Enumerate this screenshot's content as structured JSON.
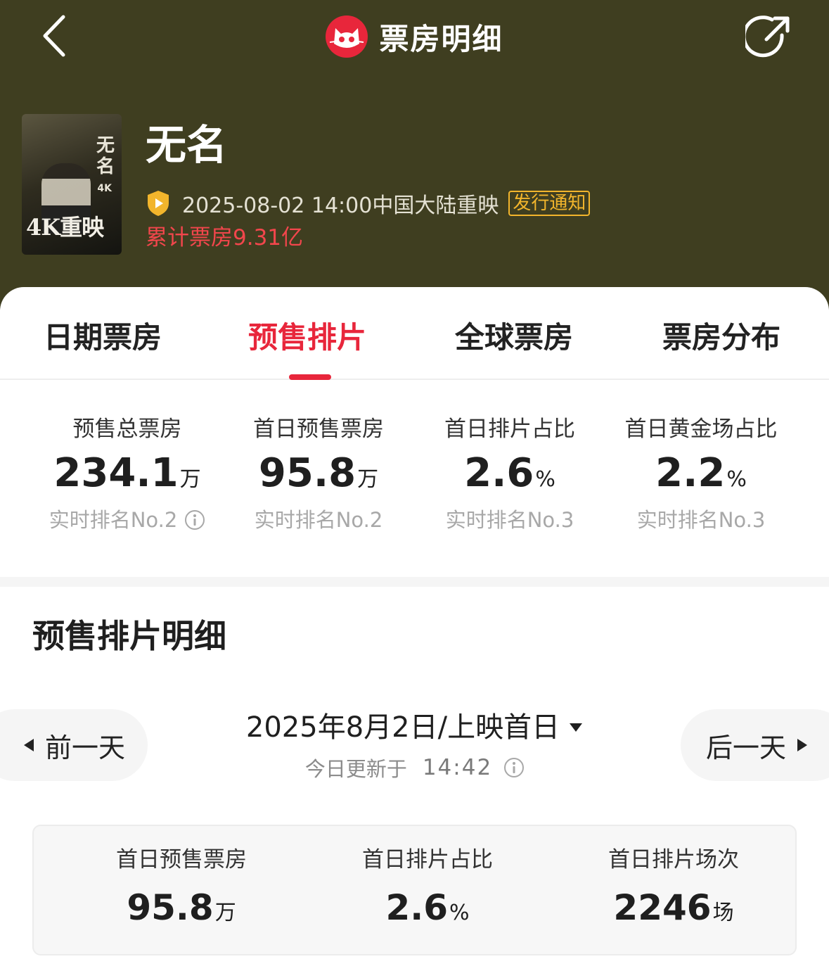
{
  "app": {
    "title": "票房明细"
  },
  "movie": {
    "name": "无名",
    "poster": {
      "title_vertical": "无名",
      "badge_small": "4K",
      "tag": "4K重映"
    },
    "release_info": "2025-08-02 14:00中国大陆重映",
    "notice_badge": "发行通知",
    "total_box_office": "累计票房9.31亿"
  },
  "tabs": [
    {
      "label": "日期票房",
      "active": false
    },
    {
      "label": "预售排片",
      "active": true
    },
    {
      "label": "全球票房",
      "active": false
    },
    {
      "label": "票房分布",
      "active": false
    }
  ],
  "stats": [
    {
      "label": "预售总票房",
      "value": "234.1",
      "unit": "万",
      "rank": "实时排名No.2",
      "has_info": true
    },
    {
      "label": "首日预售票房",
      "value": "95.8",
      "unit": "万",
      "rank": "实时排名No.2",
      "has_info": false
    },
    {
      "label": "首日排片占比",
      "value": "2.6",
      "unit": "%",
      "rank": "实时排名No.3",
      "has_info": false
    },
    {
      "label": "首日黄金场占比",
      "value": "2.2",
      "unit": "%",
      "rank": "实时排名No.3",
      "has_info": false
    }
  ],
  "detail": {
    "section_title": "预售排片明细",
    "prev_day": "前一天",
    "next_day": "后一天",
    "date_label": "2025年8月2日/上映首日",
    "update_label": "今日更新于",
    "update_time": "14:42",
    "summary": [
      {
        "label": "首日预售票房",
        "value": "95.8",
        "unit": "万"
      },
      {
        "label": "首日排片占比",
        "value": "2.6",
        "unit": "%"
      },
      {
        "label": "首日排片场次",
        "value": "2246",
        "unit": "场"
      }
    ]
  },
  "colors": {
    "header_bg": "#3f3e20",
    "accent_red": "#e8263b",
    "box_office_red": "#f2464c",
    "badge_gold": "#f2b52c"
  },
  "icons": [
    "back-arrow-icon",
    "cat-logo-icon",
    "share-icon",
    "shield-icon",
    "info-icon",
    "triangle-left-icon",
    "triangle-right-icon",
    "caret-down-icon"
  ]
}
